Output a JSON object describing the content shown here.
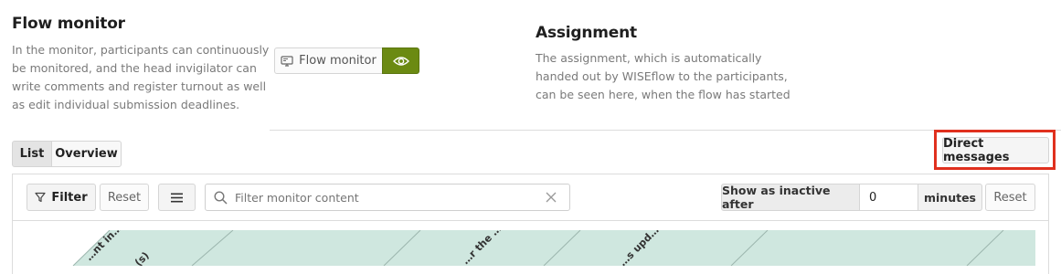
{
  "flow_monitor_section": {
    "title": "Flow monitor",
    "description_lines": [
      "In the monitor, participants can continuously",
      "be monitored, and the head invigilator can",
      "write comments and register turnout as well",
      "as edit individual submission deadlines."
    ],
    "button_label": "Flow monitor"
  },
  "assignment_section": {
    "title": "Assignment",
    "description_lines": [
      "The assignment, which is automatically",
      "handed out by WISEflow to the participants,",
      "can be seen here, when the flow has started"
    ]
  },
  "view_tabs": {
    "list": "List",
    "overview": "Overview",
    "active": "List"
  },
  "direct_messages_label": "Direct messages",
  "toolbar": {
    "filter_label": "Filter",
    "reset_label": "Reset",
    "search_placeholder": "Filter monitor content",
    "inactive_label": "Show as inactive after",
    "inactive_value": "0",
    "minutes_label": "minutes",
    "reset2_label": "Reset"
  },
  "table_headers": [
    "…nt in…",
    "(s)",
    "…r the …",
    "…s upd…"
  ],
  "colors": {
    "accent_green": "#6b8a12",
    "header_teal": "#cfe7df",
    "highlight_red": "#e0301e"
  },
  "icons": [
    "monitor-icon",
    "eye-icon",
    "filter-icon",
    "menu-icon",
    "search-icon",
    "clear-icon"
  ]
}
